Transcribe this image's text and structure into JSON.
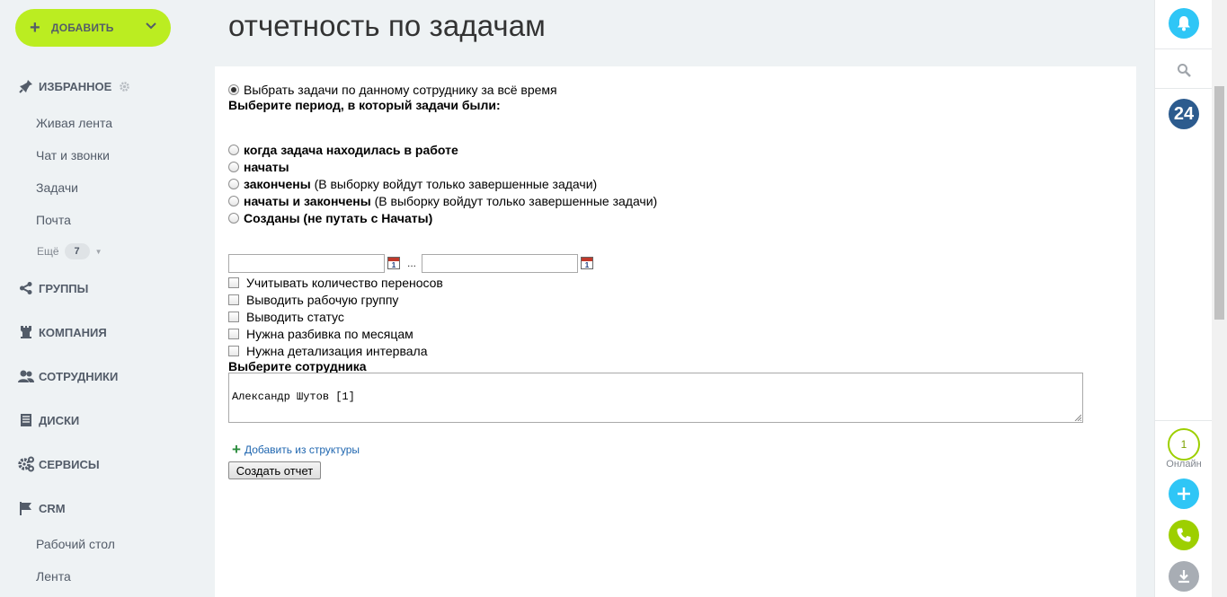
{
  "sidebar": {
    "add_label": "ДОБАВИТЬ",
    "favorites_label": "ИЗБРАННОЕ",
    "items": [
      {
        "label": "Живая лента"
      },
      {
        "label": "Чат и звонки"
      },
      {
        "label": "Задачи"
      },
      {
        "label": "Почта"
      }
    ],
    "more_label": "Ещё",
    "more_count": "7",
    "sections": [
      {
        "label": "ГРУППЫ",
        "icon": "share-icon"
      },
      {
        "label": "КОМПАНИЯ",
        "icon": "tower-icon"
      },
      {
        "label": "СОТРУДНИКИ",
        "icon": "users-icon"
      },
      {
        "label": "ДИСКИ",
        "icon": "disk-icon"
      },
      {
        "label": "СЕРВИСЫ",
        "icon": "gears-icon"
      },
      {
        "label": "CRM",
        "icon": "flag-icon"
      }
    ],
    "crm_items": [
      {
        "label": "Рабочий стол"
      },
      {
        "label": "Лента"
      }
    ]
  },
  "page": {
    "title": "отчетность по задачам"
  },
  "form": {
    "all_time_option": "Выбрать задачи по данному сотруднику за всё время",
    "period_heading": "Выберите период, в который задачи были:",
    "period_options": [
      {
        "bold": "когда задача находилась в работе",
        "note": ""
      },
      {
        "bold": "начаты",
        "note": ""
      },
      {
        "bold": "закончены",
        "note": " (В выборку войдут только завершенные задачи)"
      },
      {
        "bold": "начаты и закончены",
        "note": " (В выборку войдут только завершенные задачи)"
      },
      {
        "bold": "Созданы (не путать с Начаты)",
        "note": ""
      }
    ],
    "date_from": "",
    "date_to": "",
    "calendar_day": "1",
    "range_separator": "...",
    "checkboxes": [
      {
        "label": "Учитывать количество переносов"
      },
      {
        "label": "Выводить рабочую группу"
      },
      {
        "label": "Выводить статус"
      },
      {
        "label": "Нужна разбивка по месяцам"
      },
      {
        "label": "Нужна детализация интервала"
      }
    ],
    "employee_heading": "Выберите сотрудника",
    "employee_value": "Александр Шутов [1]",
    "add_from_structure": "Добавить из структуры",
    "submit_label": "Создать отчет"
  },
  "rightbar": {
    "online_count": "1",
    "online_label": "Онлайн",
    "logo_text": "24"
  },
  "colors": {
    "accent_green": "#bbed21",
    "bell_blue": "#2fc6f6",
    "b24_blue": "#2c5b8e",
    "phone_green": "#9dcf00",
    "download_gray": "#a8adb4"
  }
}
